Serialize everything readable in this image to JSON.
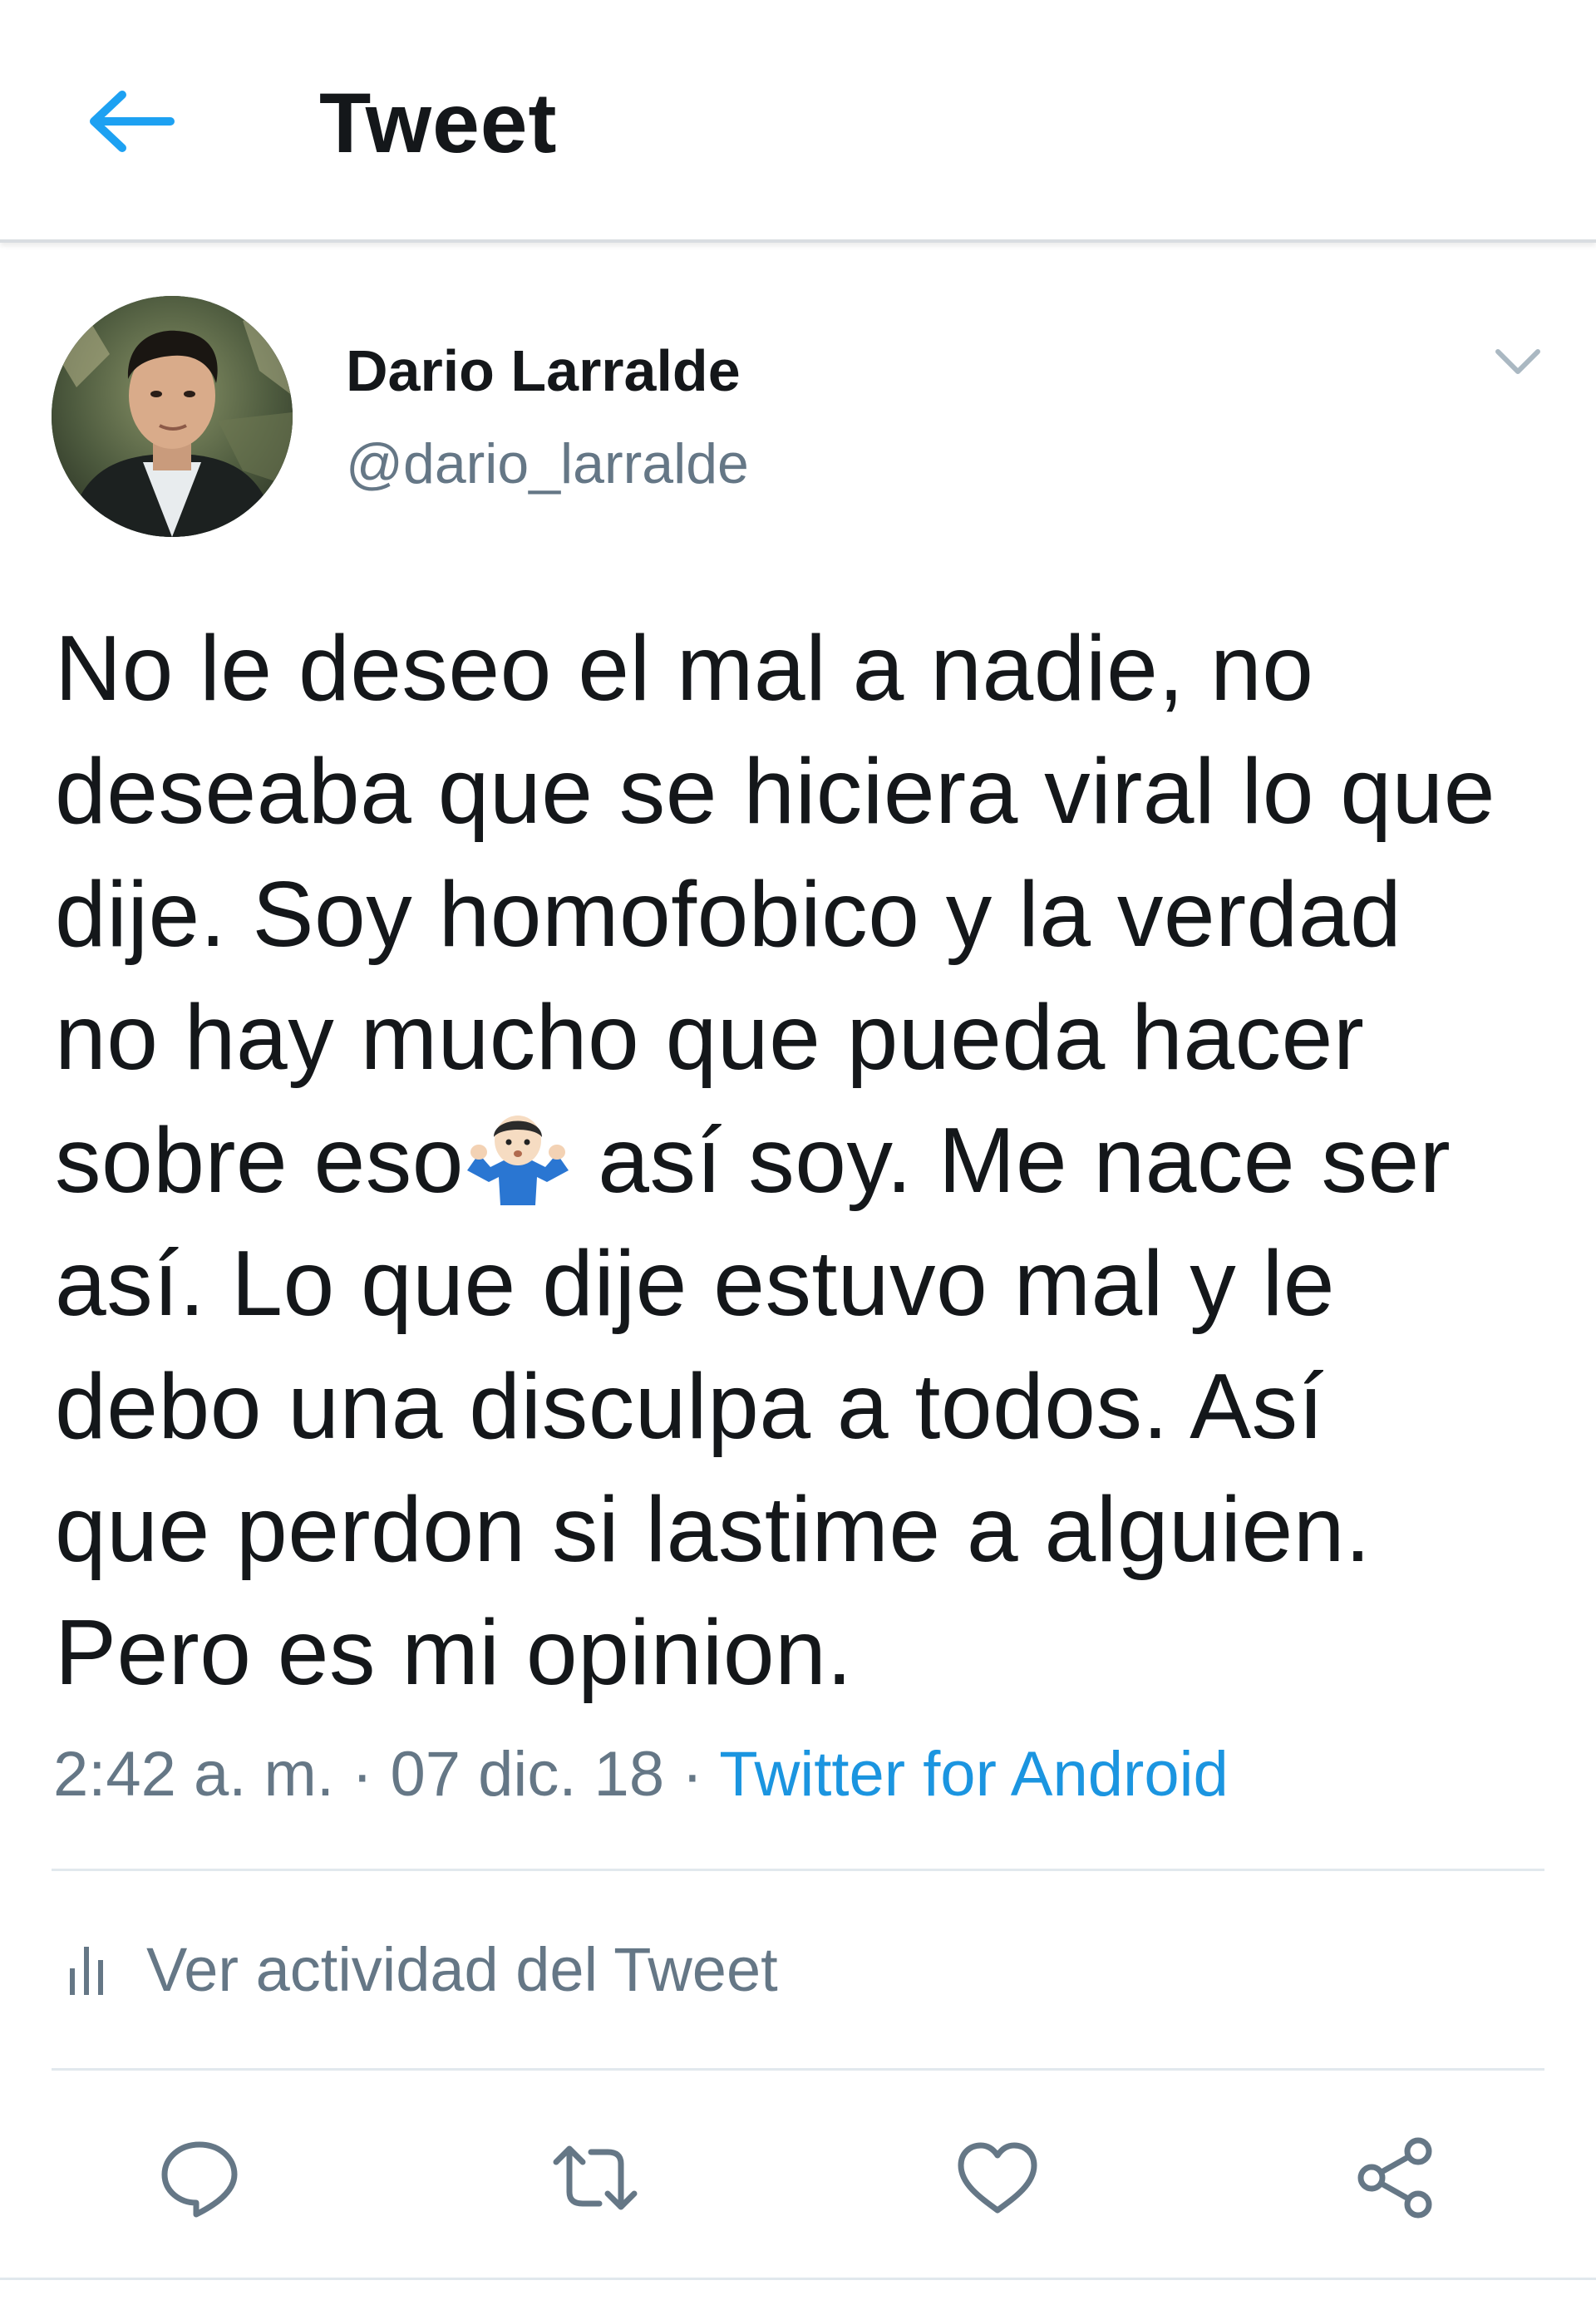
{
  "header": {
    "title": "Tweet",
    "back_icon": "arrow-left-icon",
    "accent_color": "#1da1f2"
  },
  "author": {
    "name": "Dario Larralde",
    "handle": "@dario_larralde"
  },
  "tweet": {
    "text_before_emoji": "No le deseo el mal a nadie, no\ndeseaba que se hiciera viral lo que\ndije. Soy homofobico y la verdad\nno hay mucho que pueda hacer\nsobre eso",
    "emoji": "person-shrugging-emoji",
    "text_after_emoji": " así soy. Me nace ser\nasí. Lo que dije estuvo mal y le\ndebo una disculpa a todos. Así\nque perdon si lastime a alguien.\nPero es mi opinion.",
    "time": "2:42 a. m.",
    "separator": " · ",
    "date": "07 dic. 18",
    "source": "Twitter for Android"
  },
  "activity": {
    "label": "Ver actividad del Tweet",
    "icon": "bar-chart-icon"
  },
  "actions": [
    {
      "icon": "reply-icon"
    },
    {
      "icon": "retweet-icon"
    },
    {
      "icon": "like-icon"
    },
    {
      "icon": "share-icon"
    }
  ],
  "colors": {
    "text": "#14171a",
    "secondary": "#657786",
    "link": "#1b95e0",
    "divider": "#e1e8ed"
  }
}
